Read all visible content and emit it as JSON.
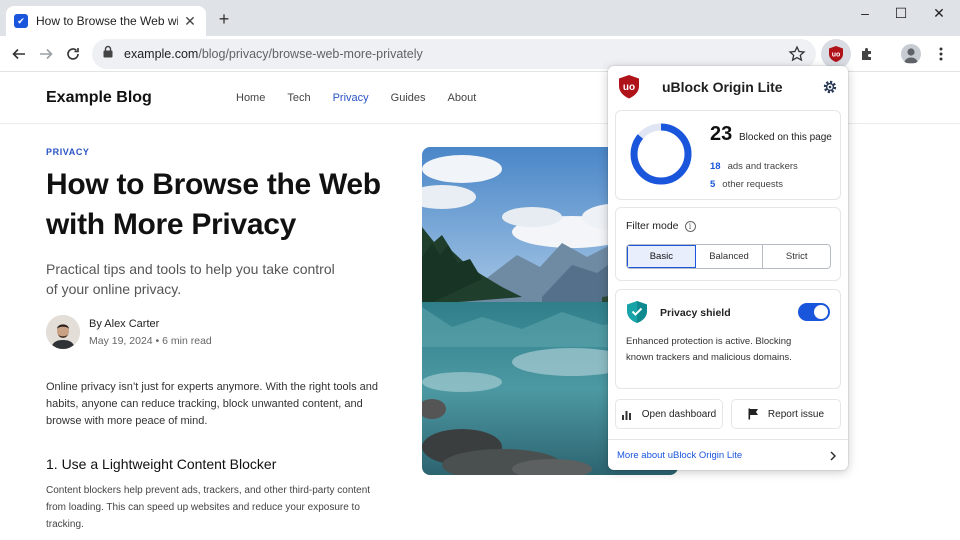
{
  "browser": {
    "tab_title": "How to Browse the Web with More Privacy",
    "favicon_label": "✔",
    "url_domain": "example.com",
    "url_path": "/blog/privacy/browse-web-more-privately"
  },
  "site": {
    "brand": "Example Blog",
    "nav": [
      "Home",
      "Tech",
      "Privacy",
      "Guides",
      "About"
    ],
    "active_nav": "Privacy"
  },
  "article": {
    "kicker": "PRIVACY",
    "headline": "How to Browse the Web with More Privacy",
    "dek": "Practical tips and tools to help you take control of your online privacy.",
    "author": "By Alex Carter",
    "meta": "May 19, 2024 • 6 min read",
    "intro": "Online privacy isn’t just for experts anymore. With the right tools and habits, anyone can reduce tracking, block unwanted content, and browse with more peace of mind.",
    "section_title": "1. Use a Lightweight Content Blocker",
    "section_body": "Content blockers help prevent ads, trackers, and other third-party content from loading. This can speed up websites and reduce your exposure to tracking."
  },
  "extension": {
    "logo_text": "uo",
    "title": "uBlock Origin Lite",
    "blocked_count": "23",
    "blocked_label": "Blocked on this page",
    "ads_count": "18",
    "ads_label": "ads and trackers",
    "other_count": "5",
    "other_label": "other requests",
    "filter_mode_label": "Filter mode",
    "filter_modes": [
      "Basic",
      "Balanced",
      "Strict"
    ],
    "selected_mode": "Basic",
    "shield_title": "Privacy shield",
    "shield_enabled": true,
    "shield_desc": "Enhanced protection is active. Blocking known trackers and malicious domains.",
    "dashboard_btn": "Open dashboard",
    "report_btn": "Report issue",
    "more_link": "More about uBlock Origin Lite"
  },
  "colors": {
    "accent": "#1a56db",
    "brand_red": "#b0121a",
    "shield_teal": "#17a3a8"
  },
  "icons": [
    "new-tab-icon",
    "back-icon",
    "forward-icon",
    "reload-icon",
    "lock-icon",
    "star-icon",
    "ublock-icon",
    "extensions-icon",
    "profile-icon",
    "menu-icon",
    "gear-icon",
    "info-icon",
    "shield-icon",
    "chart-icon",
    "flag-icon",
    "chevron-right-icon"
  ]
}
